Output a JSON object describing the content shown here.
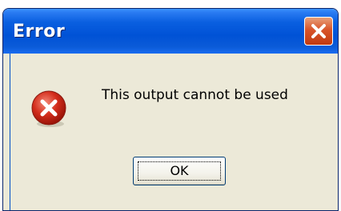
{
  "window": {
    "title": "Error",
    "close_icon": "close-icon",
    "titlebar_color": "#0052d6",
    "close_color": "#d8542a"
  },
  "dialog": {
    "icon": "error-icon",
    "icon_color": "#d32d1c",
    "message": "This output cannot be used"
  },
  "buttons": {
    "ok_label": "OK"
  }
}
